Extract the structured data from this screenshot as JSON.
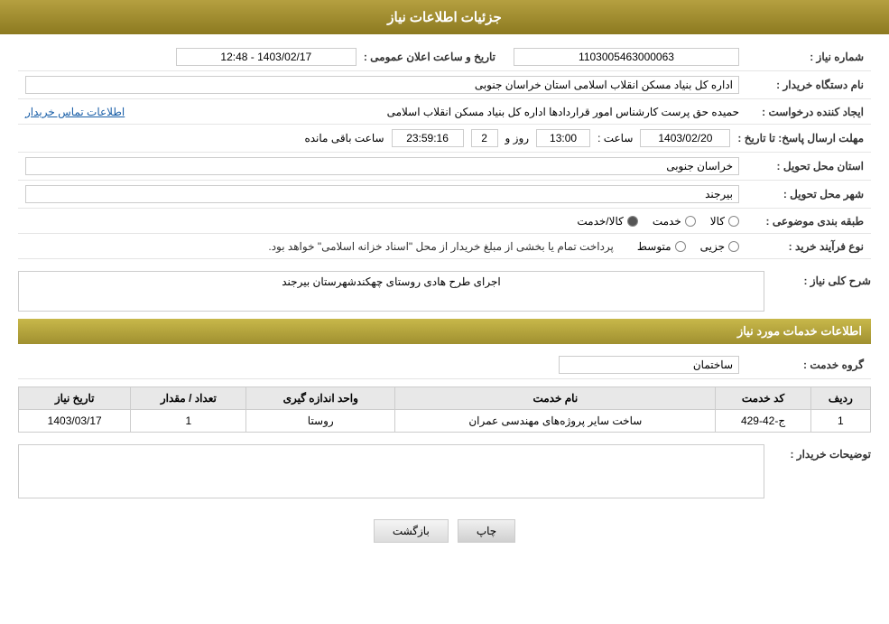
{
  "header": {
    "title": "جزئیات اطلاعات نیاز"
  },
  "info": {
    "need_number_label": "شماره نیاز :",
    "need_number_value": "1103005463000063",
    "buyer_org_label": "نام دستگاه خریدار :",
    "buyer_org_value": "اداره کل بنیاد مسکن انقلاب اسلامی استان خراسان جنوبی",
    "creator_label": "ایجاد کننده درخواست :",
    "creator_value": "حمیده حق پرست کارشناس امور قراردادها اداره کل بنیاد مسکن انقلاب اسلامی",
    "contact_link": "اطلاعات تماس خریدار",
    "deadline_label": "مهلت ارسال پاسخ: تا تاریخ :",
    "deadline_date": "1403/02/20",
    "deadline_time_label": "ساعت :",
    "deadline_time": "13:00",
    "deadline_days_label": "روز و",
    "deadline_days": "2",
    "deadline_remaining_label": "ساعت باقی مانده",
    "deadline_remaining": "23:59:16",
    "announce_label": "تاریخ و ساعت اعلان عمومی :",
    "announce_value": "1403/02/17 - 12:48",
    "province_label": "استان محل تحویل :",
    "province_value": "خراسان جنوبی",
    "city_label": "شهر محل تحویل :",
    "city_value": "بیرجند",
    "category_label": "طبقه بندی موضوعی :",
    "category_options": [
      {
        "label": "کالا",
        "selected": false
      },
      {
        "label": "خدمت",
        "selected": false
      },
      {
        "label": "کالا/خدمت",
        "selected": true
      }
    ],
    "purchase_type_label": "نوع فرآیند خرید :",
    "purchase_type_options": [
      {
        "label": "جزیی",
        "selected": false
      },
      {
        "label": "متوسط",
        "selected": false
      }
    ],
    "purchase_type_note": "پرداخت تمام یا بخشی از مبلغ خریدار از محل \"اسناد خزانه اسلامی\" خواهد بود.",
    "description_section_label": "شرح کلی نیاز :",
    "description_value": "اجرای طرح هادی روستای چهکندشهرستان بیرجند",
    "services_section_label": "اطلاعات خدمات مورد نیاز",
    "service_group_label": "گروه خدمت :",
    "service_group_value": "ساختمان",
    "table_headers": [
      "ردیف",
      "کد خدمت",
      "نام خدمت",
      "واحد اندازه گیری",
      "تعداد / مقدار",
      "تاریخ نیاز"
    ],
    "table_rows": [
      {
        "row": "1",
        "code": "ج-42-429",
        "name": "ساخت سایر پروژه‌های مهندسی عمران",
        "unit": "روستا",
        "quantity": "1",
        "date": "1403/03/17"
      }
    ],
    "buyer_notes_label": "توضیحات خریدار :",
    "buyer_notes_value": "",
    "btn_print": "چاپ",
    "btn_back": "بازگشت"
  }
}
